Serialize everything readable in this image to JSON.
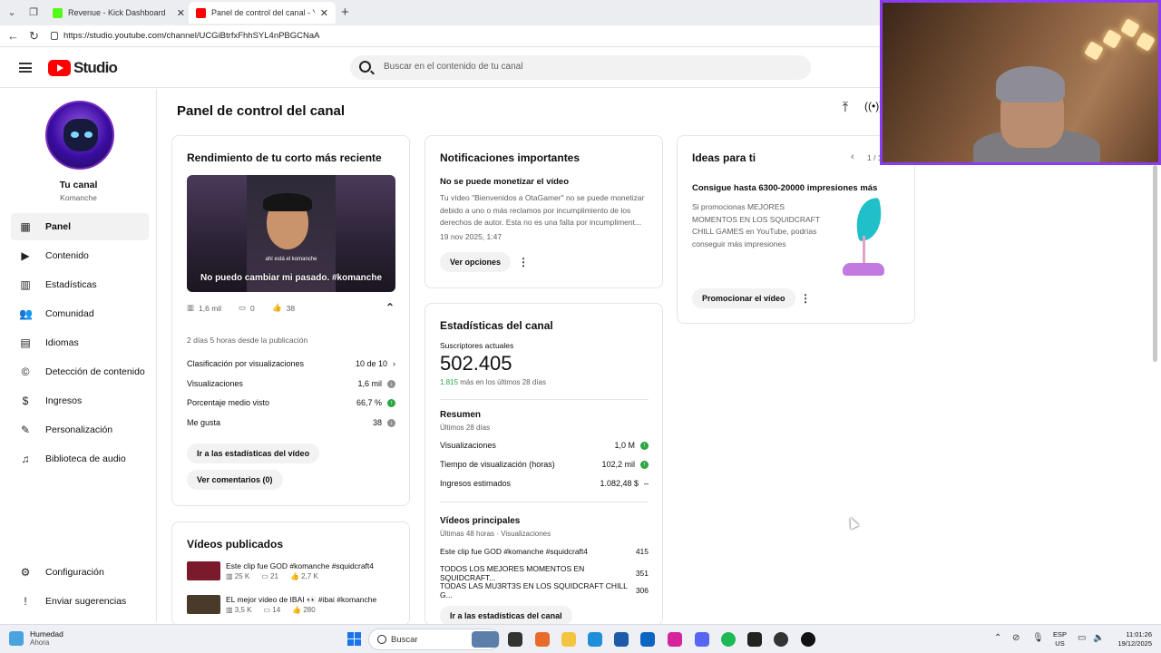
{
  "browser": {
    "tabs": [
      {
        "title": "Revenue - Kick Dashboard",
        "favicon_color": "#53fc18"
      },
      {
        "title": "Panel de control del canal - YouTu",
        "favicon_color": "#ff0000"
      }
    ],
    "url": "https://studio.youtube.com/channel/UCGiBtrfxFhhSYL4nPBGCNaA"
  },
  "header": {
    "logo_text": "Studio",
    "search_placeholder": "Buscar en el contenido de tu canal"
  },
  "sidebar": {
    "channel_title": "Tu canal",
    "channel_name": "Komanche",
    "items": [
      {
        "label": "Panel",
        "icon": "dashboard-icon",
        "glyph": "▦"
      },
      {
        "label": "Contenido",
        "icon": "content-icon",
        "glyph": "▶"
      },
      {
        "label": "Estadísticas",
        "icon": "analytics-icon",
        "glyph": "▥"
      },
      {
        "label": "Comunidad",
        "icon": "community-icon",
        "glyph": "👥"
      },
      {
        "label": "Idiomas",
        "icon": "subtitles-icon",
        "glyph": "▤"
      },
      {
        "label": "Detección de contenido",
        "icon": "copyright-icon",
        "glyph": "©"
      },
      {
        "label": "Ingresos",
        "icon": "earn-icon",
        "glyph": "$"
      },
      {
        "label": "Personalización",
        "icon": "customization-icon",
        "glyph": "✎"
      },
      {
        "label": "Biblioteca de audio",
        "icon": "audio-library-icon",
        "glyph": "♫"
      }
    ],
    "bottom": [
      {
        "label": "Configuración",
        "icon": "settings-icon",
        "glyph": "⚙"
      },
      {
        "label": "Enviar sugerencias",
        "icon": "feedback-icon",
        "glyph": "!"
      }
    ]
  },
  "page": {
    "title": "Panel de control del canal"
  },
  "latest_short": {
    "heading": "Rendimiento de tu corto más reciente",
    "thumb_subtitle": "ahí está el komanche",
    "thumb_title": "No puedo cambiar mi pasado. #komanche",
    "views": "1,6 mil",
    "comments": "0",
    "likes": "38",
    "published": "2 días 5 horas desde la publicación",
    "rows": [
      {
        "label": "Clasificación por visualizaciones",
        "value": "10 de 10",
        "indicator": "chevron"
      },
      {
        "label": "Visualizaciones",
        "value": "1,6 mil",
        "indicator": "neutral"
      },
      {
        "label": "Porcentaje medio visto",
        "value": "66,7 %",
        "indicator": "up"
      },
      {
        "label": "Me gusta",
        "value": "38",
        "indicator": "neutral"
      }
    ],
    "btn_stats": "Ir a las estadísticas del vídeo",
    "btn_comments": "Ver comentarios (0)"
  },
  "published_videos": {
    "heading": "Vídeos publicados",
    "items": [
      {
        "title": "Este clip fue GOD #komanche #squidcraft4",
        "views": "25 K",
        "comments": "21",
        "likes": "2,7 K",
        "thumb_color": "#7a1a2a"
      },
      {
        "title": "EL mejor video de IBAI 👀 #ibai #komanche",
        "views": "3,5 K",
        "comments": "14",
        "likes": "280",
        "thumb_color": "#4a3a2a"
      }
    ]
  },
  "notifications": {
    "heading": "Notificaciones importantes",
    "title": "No se puede monetizar el vídeo",
    "body": "Tu vídeo \"Bienvenidos a OtaGamer\" no se puede monetizar debido a uno o más reclamos por incumplimiento de los derechos de autor. Esta no es una falta por incumpliment...",
    "date": "19 nov 2025, 1:47",
    "button": "Ver opciones"
  },
  "channel_stats": {
    "heading": "Estadísticas del canal",
    "subs_label": "Suscriptores actuales",
    "subs_value": "502.405",
    "subs_delta": "1.815",
    "subs_delta_text": "más en los últimos 28 días",
    "summary_title": "Resumen",
    "summary_period": "Últimos 28 días",
    "summary": [
      {
        "label": "Visualizaciones",
        "value": "1,0 M",
        "indicator": "up"
      },
      {
        "label": "Tiempo de visualización (horas)",
        "value": "102,2 mil",
        "indicator": "up"
      },
      {
        "label": "Ingresos estimados",
        "value": "1.082,48 $",
        "indicator": "dash"
      }
    ],
    "top_title": "Vídeos principales",
    "top_period": "Últimas 48 horas · Visualizaciones",
    "top": [
      {
        "title": "Este clip fue GOD #komanche #squidcraft4",
        "value": "415"
      },
      {
        "title": "TODOS LOS MEJORES MOMENTOS EN SQUIDCRAFT...",
        "value": "351"
      },
      {
        "title": "TODAS LAS MU3RT3S EN LOS SQUIDCRAFT CHILL G...",
        "value": "306"
      }
    ],
    "button": "Ir a las estadísticas del canal"
  },
  "ideas": {
    "heading": "Ideas para ti",
    "pager": "1 / 1",
    "title": "Consigue hasta 6300-20000 impresiones más",
    "body": "Si promocionas MEJORES MOMENTOS EN LOS SQUIDCRAFT CHILL GAMES en YouTube, podrías conseguir más impresiones",
    "button": "Promocionar el vídeo"
  },
  "taskbar": {
    "weather_title": "Humedad",
    "weather_sub": "Ahora",
    "search": "Buscar",
    "lang1": "ESP",
    "lang2": "US",
    "time": "11:01:26",
    "date": "19/12/2025"
  }
}
